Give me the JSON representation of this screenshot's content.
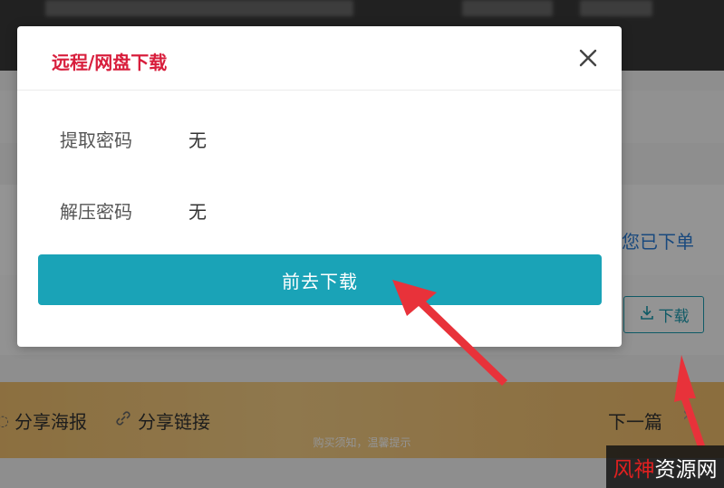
{
  "modal": {
    "title": "远程/网盘下载",
    "fields": [
      {
        "label": "提取密码",
        "value": "无"
      },
      {
        "label": "解压密码",
        "value": "无"
      }
    ],
    "go_download_label": "前去下载"
  },
  "background": {
    "order_text": "您已下单",
    "download_label": "下载",
    "share_poster": "分享海报",
    "share_link": "分享链接",
    "next_article": "下一篇",
    "purchase_notice": "购买须知，温馨提示"
  },
  "watermark": {
    "part1": "风神",
    "part2": "资源网"
  },
  "colors": {
    "title_red": "#d81e3c",
    "button_teal": "#1aa3b7",
    "arrow_red": "#e8323a",
    "share_bar": "#f3c476"
  },
  "icons": {
    "close": "close-icon",
    "download": "download-icon",
    "link": "link-icon",
    "chevron": "chevron-right-icon"
  }
}
